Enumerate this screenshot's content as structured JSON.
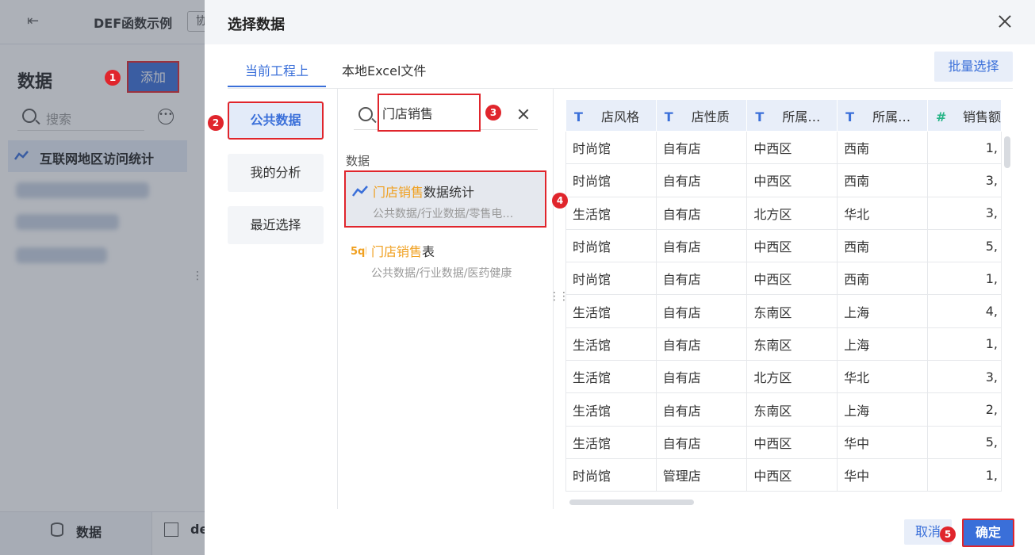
{
  "background": {
    "title": "DEF函数示例",
    "tag": "协",
    "panel_title": "数据",
    "add_button": "添加",
    "search_placeholder": "搜索",
    "active_item": "互联网地区访问统计",
    "bottom_tabs": [
      "数据",
      "de"
    ]
  },
  "dialog": {
    "title": "选择数据",
    "tabs": [
      "当前工程上",
      "本地Excel文件"
    ],
    "batch_select": "批量选择",
    "categories": [
      "公共数据",
      "我的分析",
      "最近选择"
    ],
    "search_value": "门店销售",
    "section_label": "数据",
    "results": [
      {
        "highlight": "门店销售",
        "rest": "数据统计",
        "path": "公共数据/行业数据/零售电…",
        "icon": "line-chart-icon"
      },
      {
        "highlight": "门店销售",
        "rest": "表",
        "path": "公共数据/行业数据/医药健康",
        "icon": "table-icon"
      }
    ],
    "cancel": "取消",
    "confirm": "确定"
  },
  "markers": [
    "1",
    "2",
    "3",
    "4",
    "5"
  ],
  "table": {
    "headers": [
      {
        "type": "T",
        "label": "店风格"
      },
      {
        "type": "T",
        "label": "店性质"
      },
      {
        "type": "T",
        "label": "所属…"
      },
      {
        "type": "T",
        "label": "所属…"
      },
      {
        "type": "#",
        "label": "销售额"
      }
    ],
    "rows": [
      [
        "时尚馆",
        "自有店",
        "中西区",
        "西南",
        "1,"
      ],
      [
        "时尚馆",
        "自有店",
        "中西区",
        "西南",
        "3,"
      ],
      [
        "生活馆",
        "自有店",
        "北方区",
        "华北",
        "3,"
      ],
      [
        "时尚馆",
        "自有店",
        "中西区",
        "西南",
        "5,"
      ],
      [
        "时尚馆",
        "自有店",
        "中西区",
        "西南",
        "1,"
      ],
      [
        "生活馆",
        "自有店",
        "东南区",
        "上海",
        "4,"
      ],
      [
        "生活馆",
        "自有店",
        "东南区",
        "上海",
        "1,"
      ],
      [
        "生活馆",
        "自有店",
        "北方区",
        "华北",
        "3,"
      ],
      [
        "生活馆",
        "自有店",
        "东南区",
        "上海",
        "2,"
      ],
      [
        "生活馆",
        "自有店",
        "中西区",
        "华中",
        "5,"
      ],
      [
        "时尚馆",
        "管理店",
        "中西区",
        "华中",
        "1,"
      ]
    ]
  },
  "colors": {
    "accent": "#3a6fd9",
    "highlight": "#f0a020",
    "annotation": "#e0252c"
  }
}
